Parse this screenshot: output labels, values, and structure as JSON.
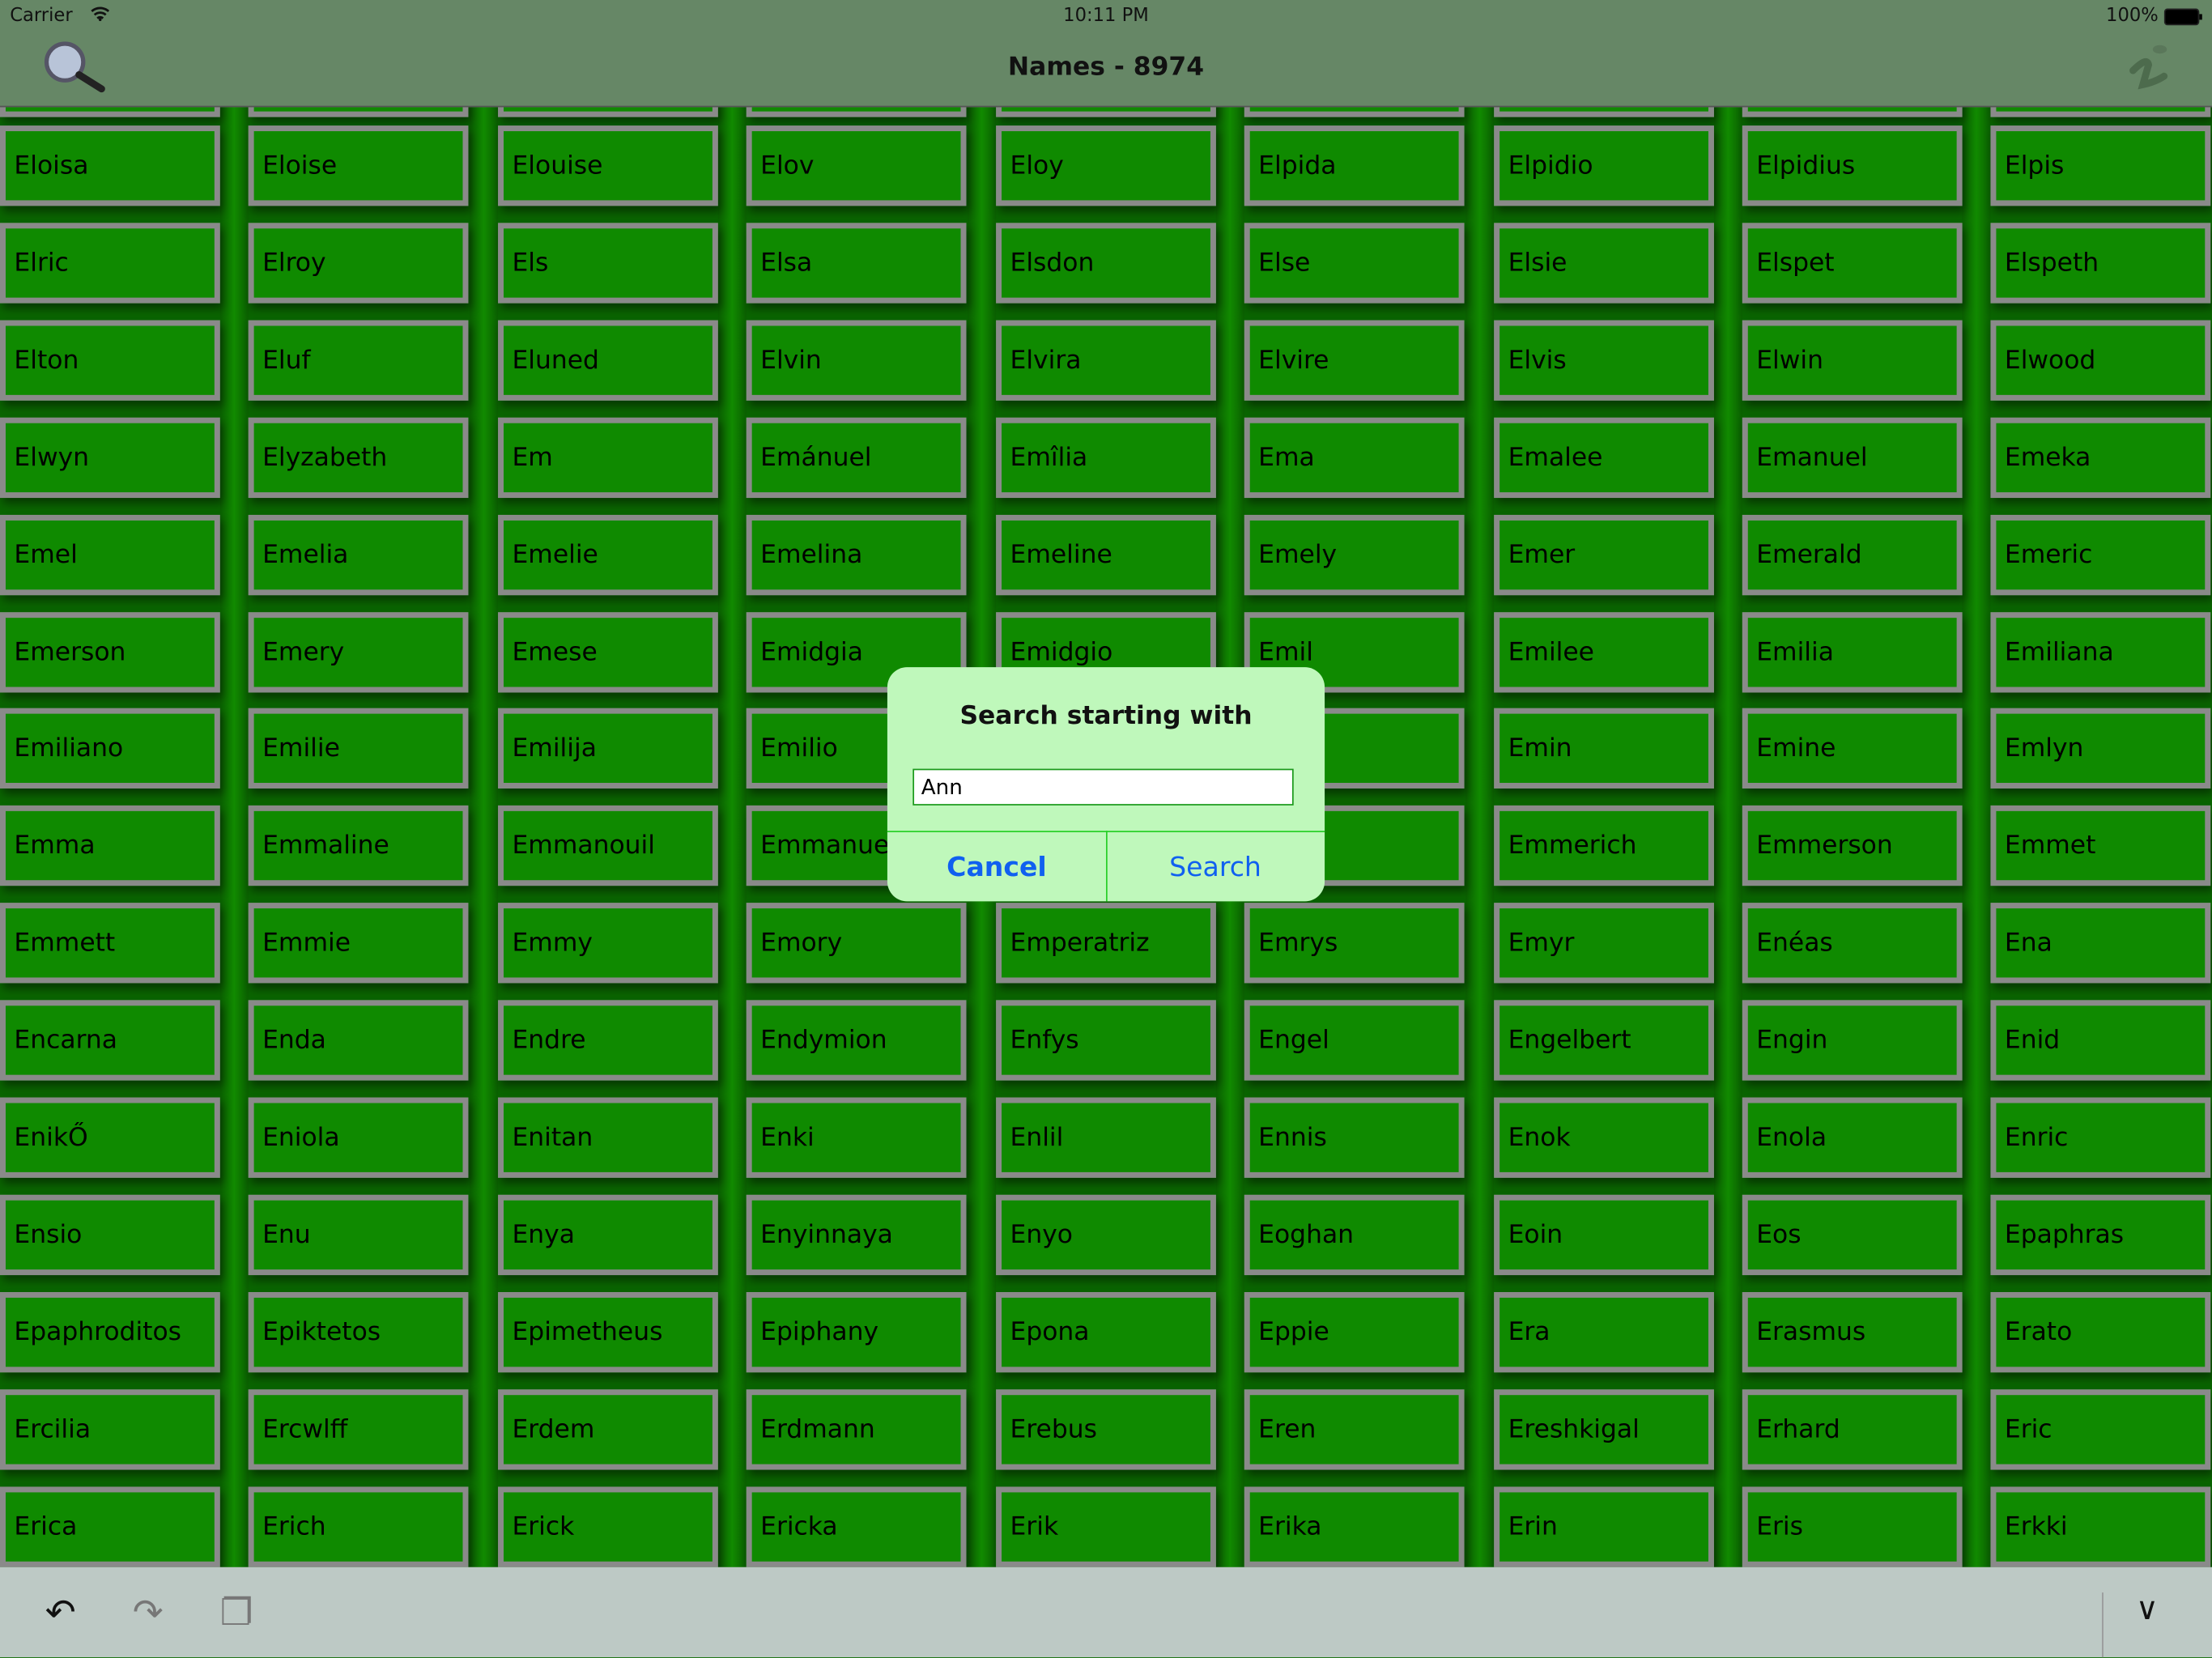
{
  "status_bar": {
    "carrier": "Carrier",
    "time": "10:11 PM",
    "battery": "100%"
  },
  "header": {
    "title": "Names - 8974",
    "search_icon": "magnifier-icon",
    "info_icon": "info-icon"
  },
  "grid": {
    "rows": [
      [
        "Eloisa",
        "Eloise",
        "Elouise",
        "Elov",
        "Eloy",
        "Elpida",
        "Elpidio",
        "Elpidius",
        "Elpis"
      ],
      [
        "Elric",
        "Elroy",
        "Els",
        "Elsa",
        "Elsdon",
        "Else",
        "Elsie",
        "Elspet",
        "Elspeth"
      ],
      [
        "Elton",
        "Eluf",
        "Eluned",
        "Elvin",
        "Elvira",
        "Elvire",
        "Elvis",
        "Elwin",
        "Elwood"
      ],
      [
        "Elwyn",
        "Elyzabeth",
        "Em",
        "Emánuel",
        "Emîlia",
        "Ema",
        "Emalee",
        "Emanuel",
        "Emeka"
      ],
      [
        "Emel",
        "Emelia",
        "Emelie",
        "Emelina",
        "Emeline",
        "Emely",
        "Emer",
        "Emerald",
        "Emeric"
      ],
      [
        "Emerson",
        "Emery",
        "Emese",
        "Emidgia",
        "Emidgio",
        "Emil",
        "Emilee",
        "Emilia",
        "Emiliana"
      ],
      [
        "Emiliano",
        "Emilie",
        "Emilija",
        "Emilio",
        "",
        "",
        "Emin",
        "Emine",
        "Emlyn"
      ],
      [
        "Emma",
        "Emmaline",
        "Emmanouil",
        "Emmanuel",
        "",
        "eline",
        "Emmerich",
        "Emmerson",
        "Emmet"
      ],
      [
        "Emmett",
        "Emmie",
        "Emmy",
        "Emory",
        "Emperatriz",
        "Emrys",
        "Emyr",
        "Enéas",
        "Ena"
      ],
      [
        "Encarna",
        "Enda",
        "Endre",
        "Endymion",
        "Enfys",
        "Engel",
        "Engelbert",
        "Engin",
        "Enid"
      ],
      [
        "EnikŐ",
        "Eniola",
        "Enitan",
        "Enki",
        "Enlil",
        "Ennis",
        "Enok",
        "Enola",
        "Enric"
      ],
      [
        "Ensio",
        "Enu",
        "Enya",
        "Enyinnaya",
        "Enyo",
        "Eoghan",
        "Eoin",
        "Eos",
        "Epaphras"
      ],
      [
        "Epaphroditos",
        "Epiktetos",
        "Epimetheus",
        "Epiphany",
        "Epona",
        "Eppie",
        "Era",
        "Erasmus",
        "Erato"
      ],
      [
        "Ercilia",
        "Ercwlff",
        "Erdem",
        "Erdmann",
        "Erebus",
        "Eren",
        "Ereshkigal",
        "Erhard",
        "Eric"
      ],
      [
        "Erica",
        "Erich",
        "Erick",
        "Ericka",
        "Erik",
        "Erika",
        "Erin",
        "Eris",
        "Erkki"
      ]
    ]
  },
  "dialog": {
    "title": "Search starting with",
    "input_value": "Ann",
    "cancel": "Cancel",
    "search": "Search"
  },
  "toolbar": {
    "undo": "↶",
    "redo": "↷",
    "paste": "❐",
    "collapse": "∨"
  },
  "colors": {
    "tile": "#0f8a00",
    "tile_border": "#8a8a8a",
    "header": "#668766",
    "dialog": "#bff8bb",
    "button_text": "#1060f0"
  }
}
